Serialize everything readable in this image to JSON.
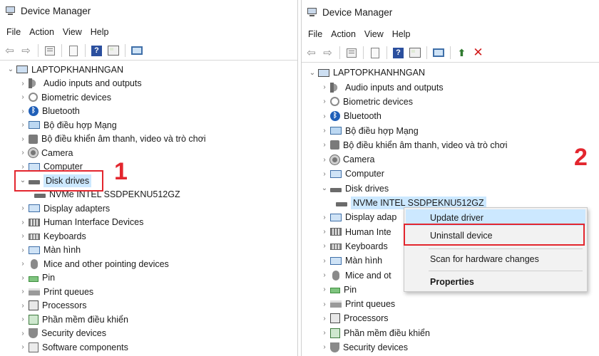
{
  "left": {
    "title": "Device Manager",
    "menu": [
      "File",
      "Action",
      "View",
      "Help"
    ],
    "root": "LAPTOPKHANHNGAN",
    "items": [
      {
        "label": "Audio inputs and outputs",
        "icon": "speaker-icon"
      },
      {
        "label": "Biometric devices",
        "icon": "fingerprint-icon"
      },
      {
        "label": "Bluetooth",
        "icon": "bluetooth-icon"
      },
      {
        "label": "Bộ điều hợp Mạng",
        "icon": "network-adapter-icon"
      },
      {
        "label": "Bộ điều khiển âm thanh, video và trò chơi",
        "icon": "sound-controller-icon"
      },
      {
        "label": "Camera",
        "icon": "camera-icon"
      },
      {
        "label": "Computer",
        "icon": "computer-icon"
      },
      {
        "label": "Disk drives",
        "icon": "disk-drive-icon",
        "expanded": true,
        "selected": true
      },
      {
        "label": "NVMe INTEL SSDPEKNU512GZ",
        "icon": "disk-drive-icon",
        "child": true
      },
      {
        "label": "Display adapters",
        "icon": "display-adapter-icon"
      },
      {
        "label": "Human Interface Devices",
        "icon": "hid-icon"
      },
      {
        "label": "Keyboards",
        "icon": "keyboard-icon"
      },
      {
        "label": "Màn hình",
        "icon": "monitor-icon"
      },
      {
        "label": "Mice and other pointing devices",
        "icon": "mouse-icon"
      },
      {
        "label": "Pin",
        "icon": "battery-icon"
      },
      {
        "label": "Print queues",
        "icon": "printer-icon"
      },
      {
        "label": "Processors",
        "icon": "processor-icon"
      },
      {
        "label": "Phần mềm điều khiển",
        "icon": "firmware-icon"
      },
      {
        "label": "Security devices",
        "icon": "security-icon"
      },
      {
        "label": "Software components",
        "icon": "software-component-icon"
      }
    ],
    "step": "1"
  },
  "right": {
    "title": "Device Manager",
    "menu": [
      "File",
      "Action",
      "View",
      "Help"
    ],
    "root": "LAPTOPKHANHNGAN",
    "items": [
      {
        "label": "Audio inputs and outputs",
        "icon": "speaker-icon"
      },
      {
        "label": "Biometric devices",
        "icon": "fingerprint-icon"
      },
      {
        "label": "Bluetooth",
        "icon": "bluetooth-icon"
      },
      {
        "label": "Bộ điều hợp Mạng",
        "icon": "network-adapter-icon"
      },
      {
        "label": "Bộ điều khiển âm thanh, video và trò chơi",
        "icon": "sound-controller-icon"
      },
      {
        "label": "Camera",
        "icon": "camera-icon"
      },
      {
        "label": "Computer",
        "icon": "computer-icon"
      },
      {
        "label": "Disk drives",
        "icon": "disk-drive-icon",
        "expanded": true
      },
      {
        "label": "NVMe INTEL SSDPEKNU512GZ",
        "icon": "disk-drive-icon",
        "child": true,
        "selected": true
      },
      {
        "label": "Display adap",
        "icon": "display-adapter-icon"
      },
      {
        "label": "Human Inte",
        "icon": "hid-icon"
      },
      {
        "label": "Keyboards",
        "icon": "keyboard-icon"
      },
      {
        "label": "Màn hình",
        "icon": "monitor-icon"
      },
      {
        "label": "Mice and ot",
        "icon": "mouse-icon"
      },
      {
        "label": "Pin",
        "icon": "battery-icon"
      },
      {
        "label": "Print queues",
        "icon": "printer-icon"
      },
      {
        "label": "Processors",
        "icon": "processor-icon"
      },
      {
        "label": "Phần mềm điều khiển",
        "icon": "firmware-icon"
      },
      {
        "label": "Security devices",
        "icon": "security-icon"
      }
    ],
    "step": "2",
    "context_menu": {
      "update": "Update driver",
      "uninstall": "Uninstall device",
      "scan": "Scan for hardware changes",
      "properties": "Properties"
    }
  },
  "colors": {
    "highlight": "#e3262e",
    "selection": "#cce8ff"
  }
}
